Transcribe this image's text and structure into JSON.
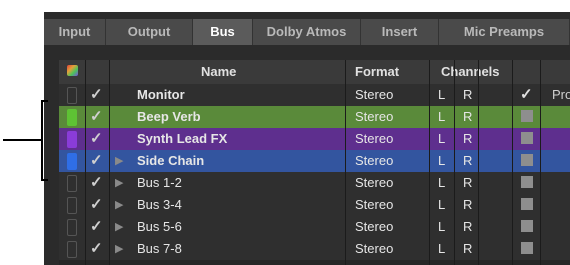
{
  "tabs": [
    {
      "label": "Input",
      "active": false
    },
    {
      "label": "Output",
      "active": false
    },
    {
      "label": "Bus",
      "active": true
    },
    {
      "label": "Dolby Atmos",
      "active": false
    },
    {
      "label": "Insert",
      "active": false
    },
    {
      "label": "Mic Preamps",
      "active": false
    }
  ],
  "header": {
    "color_icon": "color-palette-icon",
    "name": "Name",
    "format": "Format",
    "channels": "Channels"
  },
  "rows": [
    {
      "name": "Monitor",
      "format": "Stereo",
      "ch_l": "L",
      "ch_r": "R",
      "color": "",
      "row_bg": "#2f2f2f",
      "expandable": false,
      "bold": true,
      "active_checked": true,
      "extra": "Pro"
    },
    {
      "name": "Beep Verb",
      "format": "Stereo",
      "ch_l": "L",
      "ch_r": "R",
      "color": "#5ec234",
      "row_bg": "#5a8a3a",
      "expandable": false,
      "bold": true,
      "active_checked": false,
      "extra": ""
    },
    {
      "name": "Synth Lead FX",
      "format": "Stereo",
      "ch_l": "L",
      "ch_r": "R",
      "color": "#8a3cd8",
      "row_bg": "#5e2f8e",
      "expandable": false,
      "bold": true,
      "active_checked": false,
      "extra": ""
    },
    {
      "name": "Side Chain",
      "format": "Stereo",
      "ch_l": "L",
      "ch_r": "R",
      "color": "#2f6ee6",
      "row_bg": "#33559f",
      "expandable": true,
      "bold": true,
      "active_checked": false,
      "extra": ""
    },
    {
      "name": "Bus 1-2",
      "format": "Stereo",
      "ch_l": "L",
      "ch_r": "R",
      "color": "",
      "row_bg": "#2f2f2f",
      "expandable": true,
      "bold": false,
      "active_checked": false,
      "extra": ""
    },
    {
      "name": "Bus 3-4",
      "format": "Stereo",
      "ch_l": "L",
      "ch_r": "R",
      "color": "",
      "row_bg": "#2f2f2f",
      "expandable": true,
      "bold": false,
      "active_checked": false,
      "extra": ""
    },
    {
      "name": "Bus 5-6",
      "format": "Stereo",
      "ch_l": "L",
      "ch_r": "R",
      "color": "",
      "row_bg": "#2f2f2f",
      "expandable": true,
      "bold": false,
      "active_checked": false,
      "extra": ""
    },
    {
      "name": "Bus 7-8",
      "format": "Stereo",
      "ch_l": "L",
      "ch_r": "R",
      "color": "",
      "row_bg": "#2f2f2f",
      "expandable": true,
      "bold": false,
      "active_checked": false,
      "extra": ""
    }
  ],
  "icons": {
    "check": "checkmark-icon",
    "expand": "disclosure-triangle-icon"
  }
}
